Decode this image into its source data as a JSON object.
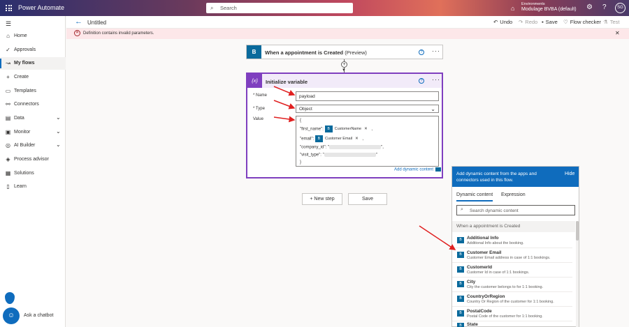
{
  "topbar": {
    "app_title": "Power Automate",
    "search_placeholder": "Search",
    "env_label": "Environments",
    "env_value": "Modulage BVBA (default)",
    "user_initials": "SG"
  },
  "sidebar": {
    "items": [
      {
        "label": "Home",
        "icon": "home-icon"
      },
      {
        "label": "Approvals",
        "icon": "approvals-icon"
      },
      {
        "label": "My flows",
        "icon": "flows-icon"
      },
      {
        "label": "Create",
        "icon": "plus-icon"
      },
      {
        "label": "Templates",
        "icon": "templates-icon"
      },
      {
        "label": "Connectors",
        "icon": "connectors-icon"
      },
      {
        "label": "Data",
        "icon": "data-icon"
      },
      {
        "label": "Monitor",
        "icon": "monitor-icon"
      },
      {
        "label": "AI Builder",
        "icon": "ai-builder-icon"
      },
      {
        "label": "Process advisor",
        "icon": "process-advisor-icon"
      },
      {
        "label": "Solutions",
        "icon": "solutions-icon"
      },
      {
        "label": "Learn",
        "icon": "learn-icon"
      }
    ],
    "active": "My flows",
    "chatbot_label": "Ask a chatbot"
  },
  "cmdbar": {
    "flow_title": "Untitled",
    "undo": "Undo",
    "redo": "Redo",
    "save": "Save",
    "flow_checker": "Flow checker",
    "test": "Test"
  },
  "error": {
    "message": "Definition contains invalid parameters."
  },
  "trigger": {
    "title": "When a appointment is Created",
    "suffix": "(Preview)"
  },
  "init_variable": {
    "title": "Initialize variable",
    "name_label": "* Name",
    "name_value": "payload",
    "type_label": "* Type",
    "type_value": "Object",
    "value_label": "Value",
    "lines": {
      "open": "{",
      "first_name_key": "\"first_name\":",
      "email_key": "\"email\":",
      "company_id": "\"company_id\": \"",
      "visit_type": "\"visit_type\": \"",
      "close": "}"
    },
    "tokens": {
      "customer_name": "CustomerName",
      "customer_email": "Customer Email"
    },
    "add_dynamic": "Add dynamic content"
  },
  "buttons": {
    "new_step": "+ New step",
    "save": "Save"
  },
  "panel": {
    "description": "Add dynamic content from the apps and connectors used in this flow.",
    "hide": "Hide",
    "tab_dynamic": "Dynamic content",
    "tab_expression": "Expression",
    "search_placeholder": "Search dynamic content",
    "section": "When a appointment is Created",
    "items": [
      {
        "name": "Additional Info",
        "desc": "Additional Info about the booking."
      },
      {
        "name": "Customer Email",
        "desc": "Customer Email address in case of 1:1 bookings."
      },
      {
        "name": "CustomerId",
        "desc": "Customer Id in case of 1:1 bookings."
      },
      {
        "name": "City",
        "desc": "City the customer belongs to for 1:1 booking."
      },
      {
        "name": "CountryOrRegion",
        "desc": "Country Or Region of the customer for 1:1 booking."
      },
      {
        "name": "PostalCode",
        "desc": "Postal Code of the customer for 1:1 booking."
      },
      {
        "name": "State",
        "desc": ""
      }
    ]
  },
  "colors": {
    "accent": "#0f6cbd",
    "variable_purple": "#7f3fbf",
    "bookings_blue": "#0a6a9c",
    "error_bg": "#fde7e9",
    "annotation_red": "#e02020"
  }
}
